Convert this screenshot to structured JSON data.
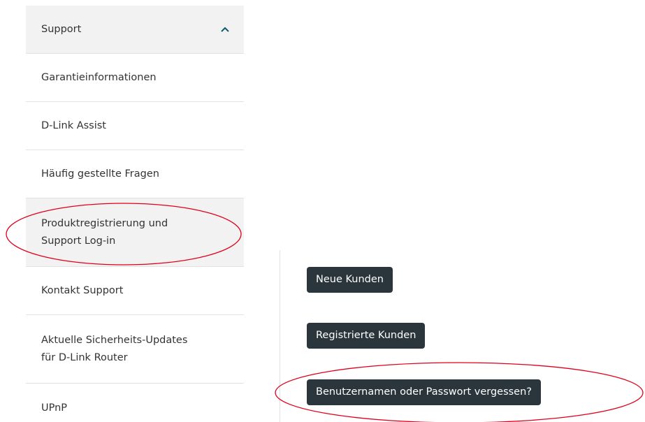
{
  "sidebar": {
    "header": {
      "label": "Support",
      "icon": "chevron-up-icon",
      "expanded": true
    },
    "items": [
      {
        "label": "Garantieinformationen"
      },
      {
        "label": "D-Link Assist"
      },
      {
        "label": "Häufig gestellte Fragen"
      },
      {
        "label": "Produktregistrierung und Support Log-in",
        "active": true
      },
      {
        "label": "Kontakt Support"
      },
      {
        "label": "Aktuelle Sicherheits-Updates für D-Link Router"
      },
      {
        "label": "UPnP"
      }
    ]
  },
  "main": {
    "buttons": {
      "new_customers": "Neue Kunden",
      "registered_customers": "Registrierte Kunden",
      "forgot_credentials": "Benutzernamen oder Passwort vergessen?"
    }
  },
  "colors": {
    "button_bg": "#2b363c",
    "nav_active_bg": "#f2f2f2",
    "annotation": "#e0001a"
  }
}
